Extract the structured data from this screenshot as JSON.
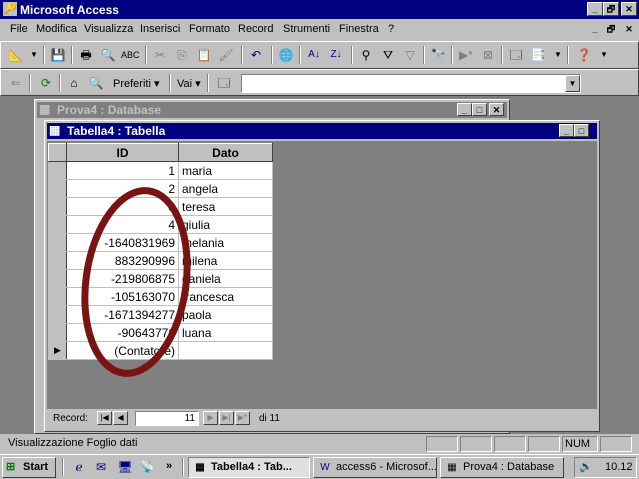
{
  "app": {
    "title": "Microsoft Access",
    "min_label": "_",
    "restore_label": "🗗",
    "close_label": "✕"
  },
  "menu": [
    "File",
    "Modifica",
    "Visualizza",
    "Inserisci",
    "Formato",
    "Record",
    "Strumenti",
    "Finestra",
    "?"
  ],
  "web_toolbar": {
    "favorites_label": "Preferiti ▾",
    "go_label": "Vai ▾",
    "address_value": ""
  },
  "db_window": {
    "title": "Prova4 : Database"
  },
  "table_window": {
    "title": "Tabella4 : Tabella",
    "columns": [
      "ID",
      "Dato"
    ],
    "rows": [
      {
        "id": "1",
        "dato": "maria"
      },
      {
        "id": "2",
        "dato": "angela"
      },
      {
        "id": "3",
        "dato": "teresa"
      },
      {
        "id": "4",
        "dato": "giulia"
      },
      {
        "id": "-1640831969",
        "dato": "melania"
      },
      {
        "id": "883290996",
        "dato": "milena"
      },
      {
        "id": "-219806875",
        "dato": "daniela"
      },
      {
        "id": "-105163070",
        "dato": "francesca"
      },
      {
        "id": "-1671394277",
        "dato": "paola"
      },
      {
        "id": "-90643776",
        "dato": "luana"
      }
    ],
    "new_row": {
      "id": "(Contatore)",
      "dato": ""
    },
    "record_nav": {
      "label": "Record:",
      "current": "11",
      "of_label": "di 11"
    }
  },
  "status": {
    "text": "Visualizzazione Foglio dati",
    "num": "NUM"
  },
  "taskbar": {
    "start": "Start",
    "tasks": [
      {
        "label": "Tabella4 : Tab...",
        "icon": "table-icon",
        "active": true
      },
      {
        "label": "access6 - Microsof...",
        "icon": "word-icon",
        "active": false
      },
      {
        "label": "Prova4 : Database",
        "icon": "database-icon",
        "active": false
      }
    ],
    "clock": "10.12",
    "quicklaunch_arrow": "»"
  },
  "colors": {
    "title_active": "#000080",
    "annotation_ellipse": "#7a1414"
  }
}
